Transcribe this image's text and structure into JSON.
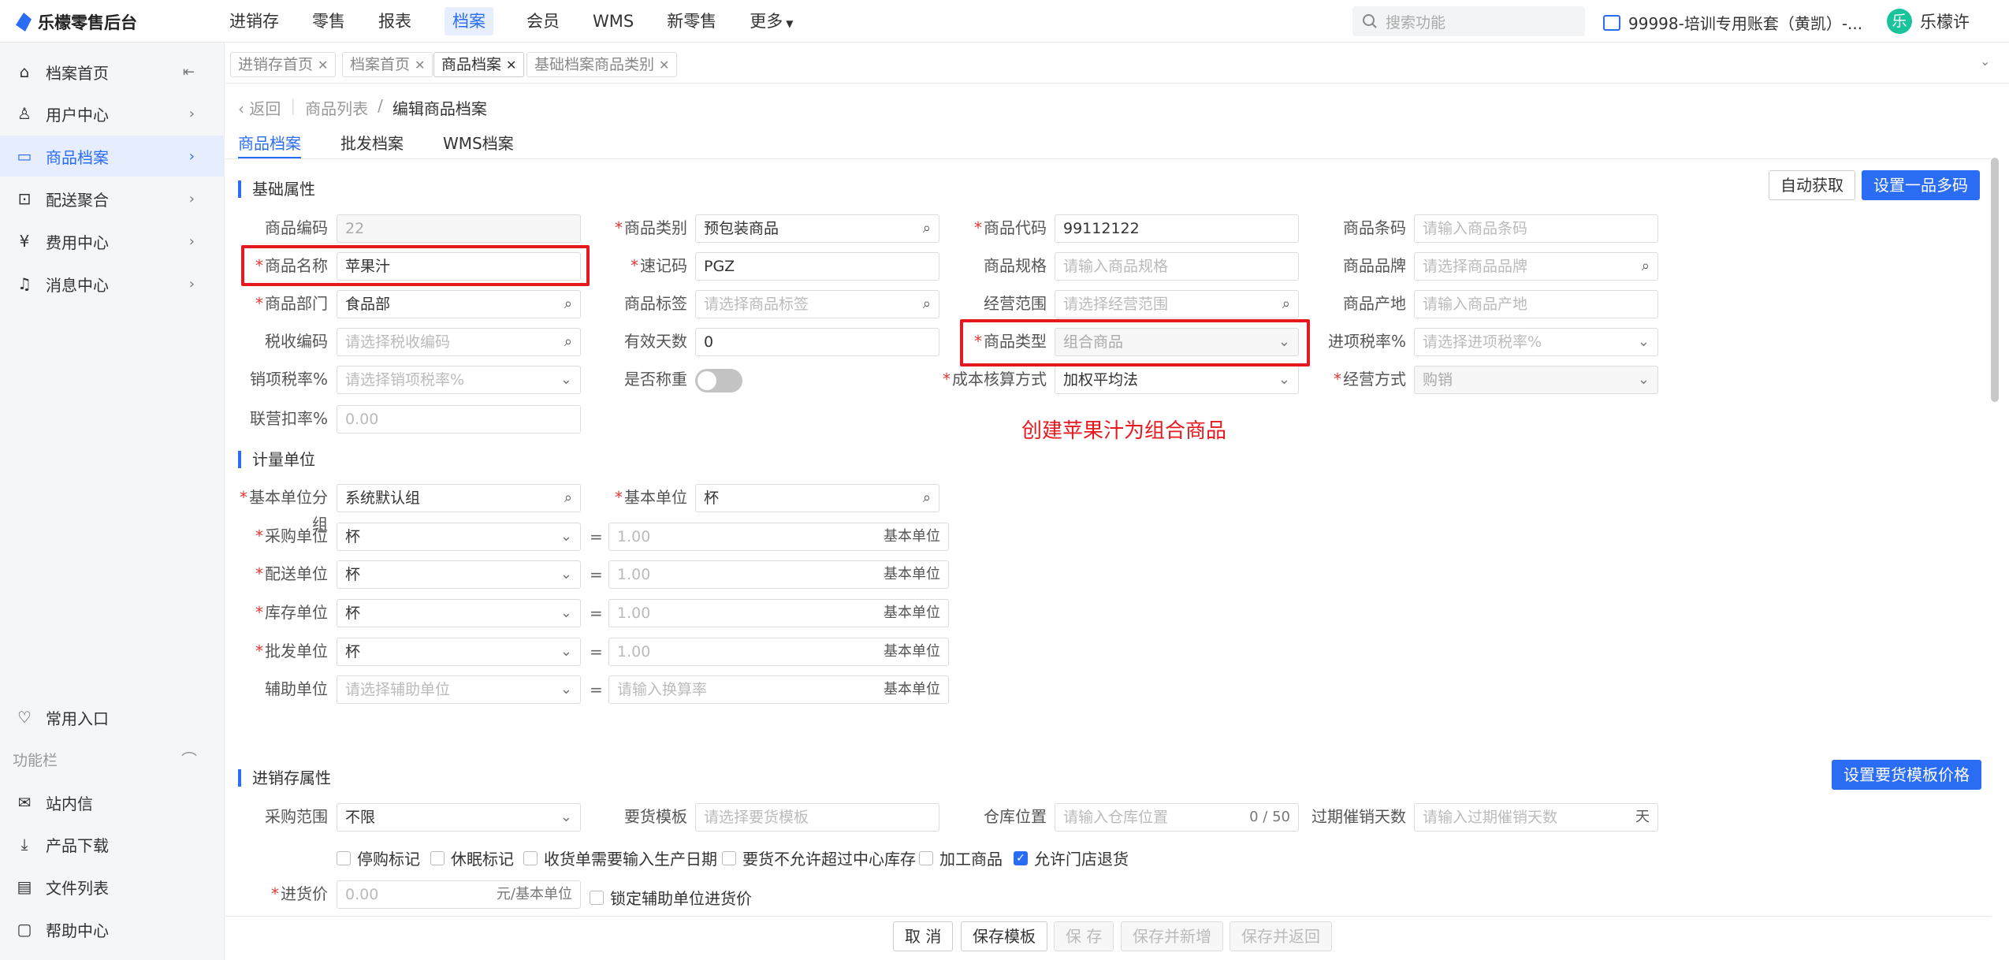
{
  "brand": "乐檬零售后台",
  "topnav": [
    "进销存",
    "零售",
    "报表",
    "档案",
    "会员",
    "WMS",
    "新零售",
    "更多"
  ],
  "search_placeholder": "搜索功能",
  "account": "99998-培训专用账套（黄凯）-...",
  "user": {
    "avatar": "乐",
    "name": "乐檬许"
  },
  "sidebar": {
    "items": [
      "档案首页",
      "用户中心",
      "商品档案",
      "配送聚合",
      "费用中心",
      "消息中心"
    ],
    "common": "常用入口",
    "func_label": "功能栏",
    "bottom": [
      "站内信",
      "产品下载",
      "文件列表",
      "帮助中心"
    ]
  },
  "tabs": [
    "进销存首页",
    "档案首页",
    "商品档案",
    "基础档案商品类别"
  ],
  "breadcrumb": {
    "back": "返回",
    "parent": "商品列表",
    "sep": "/",
    "current": "编辑商品档案"
  },
  "subtabs": [
    "商品档案",
    "批发档案",
    "WMS档案"
  ],
  "sections": {
    "basic": "基础属性",
    "unit": "计量单位",
    "inventory": "进销存属性"
  },
  "buttons": {
    "auto": "自动获取",
    "multi": "设置一品多码",
    "template_price": "设置要货模板价格"
  },
  "fields": {
    "code": {
      "label": "商品编码",
      "value": "22"
    },
    "category": {
      "label": "商品类别",
      "value": "预包装商品"
    },
    "prodcode": {
      "label": "商品代码",
      "value": "99112122"
    },
    "barcode": {
      "label": "商品条码",
      "placeholder": "请输入商品条码"
    },
    "name": {
      "label": "商品名称",
      "value": "苹果汁"
    },
    "quick": {
      "label": "速记码",
      "value": "PGZ"
    },
    "spec": {
      "label": "商品规格",
      "placeholder": "请输入商品规格"
    },
    "brand": {
      "label": "商品品牌",
      "placeholder": "请选择商品品牌"
    },
    "dept": {
      "label": "商品部门",
      "value": "食品部"
    },
    "tag": {
      "label": "商品标签",
      "placeholder": "请选择商品标签"
    },
    "scope": {
      "label": "经营范围",
      "placeholder": "请选择经营范围"
    },
    "origin": {
      "label": "商品产地",
      "placeholder": "请输入商品产地"
    },
    "tax": {
      "label": "税收编码",
      "placeholder": "请选择税收编码"
    },
    "days": {
      "label": "有效天数",
      "value": "0"
    },
    "type": {
      "label": "商品类型",
      "value": "组合商品"
    },
    "intax": {
      "label": "进项税率%",
      "placeholder": "请选择进项税率%"
    },
    "outtax": {
      "label": "销项税率%",
      "placeholder": "请选择销项税率%"
    },
    "weigh": {
      "label": "是否称重"
    },
    "cost": {
      "label": "成本核算方式",
      "value": "加权平均法"
    },
    "mode": {
      "label": "经营方式",
      "value": "购销"
    },
    "deduct": {
      "label": "联营扣率%",
      "value": "0.00"
    }
  },
  "annotation": "创建苹果汁为组合商品",
  "units": {
    "group": {
      "label": "基本单位分组",
      "value": "系统默认组"
    },
    "base": {
      "label": "基本单位",
      "value": "杯"
    },
    "rows": [
      {
        "label": "采购单位",
        "value": "杯",
        "rate": "1.00",
        "suffix": "基本单位"
      },
      {
        "label": "配送单位",
        "value": "杯",
        "rate": "1.00",
        "suffix": "基本单位"
      },
      {
        "label": "库存单位",
        "value": "杯",
        "rate": "1.00",
        "suffix": "基本单位"
      },
      {
        "label": "批发单位",
        "value": "杯",
        "rate": "1.00",
        "suffix": "基本单位"
      }
    ],
    "aux": {
      "label": "辅助单位",
      "placeholder": "请选择辅助单位",
      "rate_placeholder": "请输入换算率",
      "suffix": "基本单位"
    },
    "eq": "="
  },
  "inventory": {
    "purchase_scope": {
      "label": "采购范围",
      "value": "不限"
    },
    "template": {
      "label": "要货模板",
      "placeholder": "请选择要货模板"
    },
    "location": {
      "label": "仓库位置",
      "placeholder": "请输入仓库位置",
      "count": "0 / 50"
    },
    "overdue": {
      "label": "过期催销天数",
      "placeholder": "请输入过期催销天数",
      "suffix": "天"
    },
    "checks": [
      {
        "label": "停购标记",
        "on": false
      },
      {
        "label": "休眠标记",
        "on": false
      },
      {
        "label": "收货单需要输入生产日期",
        "on": false
      },
      {
        "label": "要货不允许超过中心库存",
        "on": false
      },
      {
        "label": "加工商品",
        "on": false
      },
      {
        "label": "允许门店退货",
        "on": true
      }
    ],
    "price": {
      "label": "进货价",
      "value": "0.00",
      "suffix": "元/基本单位"
    },
    "lock": "锁定辅助单位进货价"
  },
  "footer": [
    "取 消",
    "保存模板",
    "保 存",
    "保存并新增",
    "保存并返回"
  ]
}
